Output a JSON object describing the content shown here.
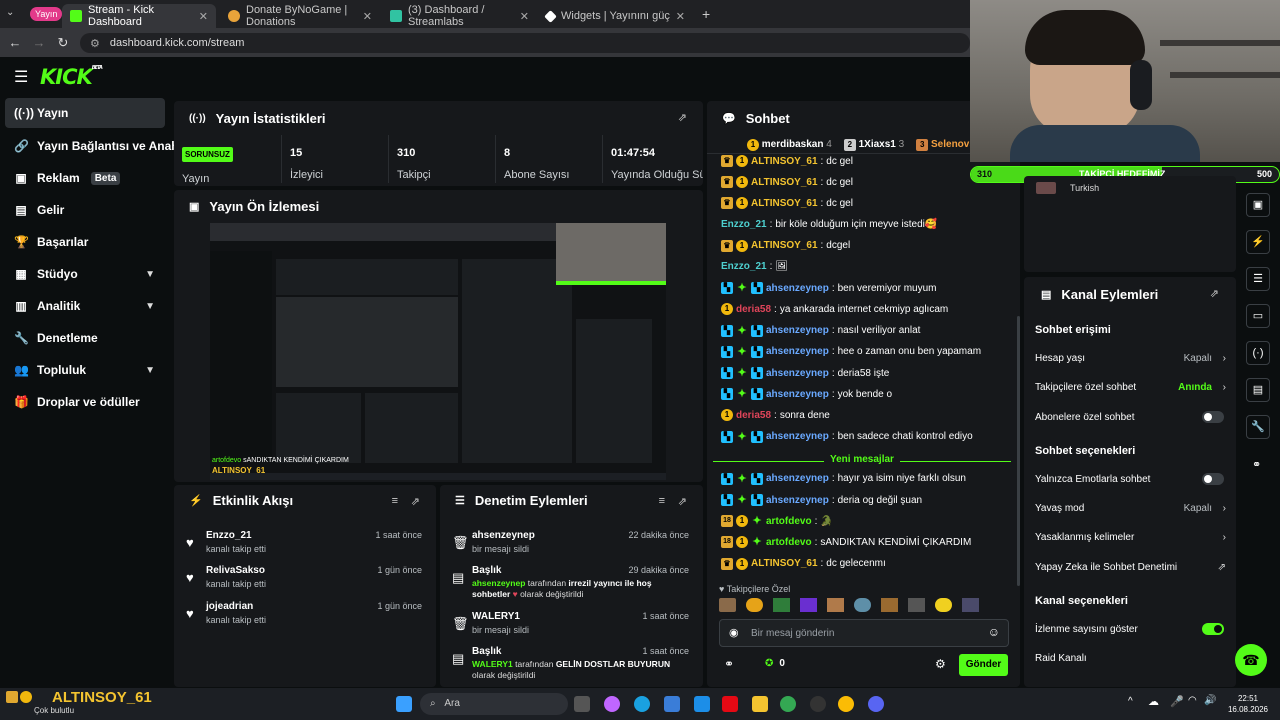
{
  "browser": {
    "profile_label": "Yayın",
    "tabs": [
      {
        "title": "Stream - Kick Dashboard",
        "active": true,
        "color": "#53fc18"
      },
      {
        "title": "Donate ByNoGame | Donations",
        "active": false,
        "color": "#e8a33a"
      },
      {
        "title": "(3) Dashboard / Streamlabs",
        "active": false,
        "color": "#31c3a2"
      },
      {
        "title": "Widgets | Yayınını güçlendirme",
        "active": false,
        "color": "#ffffff"
      }
    ],
    "url": "dashboard.kick.com/stream"
  },
  "header": {
    "logo": "KICK",
    "logo_sup": "BETA"
  },
  "sidebar": {
    "items": [
      {
        "label": "Yayın",
        "icon": "broadcast-icon",
        "active": true
      },
      {
        "label": "Yayın Bağlantısı ve Anahtarı",
        "icon": "link-icon"
      },
      {
        "label": "Reklam",
        "icon": "ad-icon",
        "badge": "Beta"
      },
      {
        "label": "Gelir",
        "icon": "revenue-icon"
      },
      {
        "label": "Başarılar",
        "icon": "trophy-icon"
      },
      {
        "label": "Stüdyo",
        "icon": "studio-icon",
        "expandable": true
      },
      {
        "label": "Analitik",
        "icon": "analytics-icon",
        "expandable": true
      },
      {
        "label": "Denetleme",
        "icon": "wrench-icon"
      },
      {
        "label": "Topluluk",
        "icon": "community-icon",
        "expandable": true
      },
      {
        "label": "Droplar ve ödüller",
        "icon": "gift-icon"
      }
    ]
  },
  "stats": {
    "title": "Yayın İstatistikleri",
    "status_badge": "SORUNSUZ",
    "status_label": "Yayın",
    "items": [
      {
        "value": "15",
        "label": "İzleyici"
      },
      {
        "value": "310",
        "label": "Takipçi"
      },
      {
        "value": "8",
        "label": "Abone Sayısı"
      },
      {
        "value": "01:47:54",
        "label": "Yayında Olduğu Süre"
      }
    ]
  },
  "preview": {
    "title": "Yayın Ön İzlemesi",
    "overlay_user": "artofdevo",
    "overlay_text": "sANDIKTAN KENDİMİ ÇIKARDIM",
    "overlay_name": "ALTINSOY_61"
  },
  "activity": {
    "title": "Etkinlik Akışı",
    "events": [
      {
        "name": "Enzzo_21",
        "desc": "kanalı takip etti",
        "time": "1 saat önce"
      },
      {
        "name": "RelivaSakso",
        "desc": "kanalı takip etti",
        "time": "1 gün önce"
      },
      {
        "name": "jojeadrian",
        "desc": "kanalı takip etti",
        "time": "1 gün önce"
      }
    ]
  },
  "moderation": {
    "title": "Denetim Eylemleri",
    "events": [
      {
        "name": "ahsenzeynep",
        "desc": "bir mesajı sildi",
        "time": "22 dakika önce",
        "icon": "trash-icon"
      },
      {
        "name": "Başlık",
        "actor": "ahsenzeynep",
        "mid": "tarafından",
        "from": "irrezil yayıncı ile hoş sohbetler",
        "to": "olarak değiştirildi",
        "time": "29 dakika önce",
        "icon": "title-icon"
      },
      {
        "name": "WALERY1",
        "desc": "bir mesajı sildi",
        "time": "1 saat önce",
        "icon": "trash-icon"
      },
      {
        "name": "Başlık",
        "actor": "WALERY1",
        "mid": "tarafından",
        "from": "GELİN DOSTLAR BUYURUN",
        "to": "olarak değiştirildi",
        "time": "1 saat önce",
        "icon": "title-icon"
      }
    ]
  },
  "chat": {
    "title": "Sohbet",
    "top_gifters": [
      {
        "rank": "1",
        "name": "merdibaskan",
        "count": "4"
      },
      {
        "rank": "2",
        "name": "1Xiaxs1",
        "count": "3"
      },
      {
        "rank": "3",
        "name": "Selenovsk",
        "count": ""
      }
    ],
    "messages": [
      {
        "user": "ALTINSOY_61",
        "cls": "u-alt",
        "badges": [
          "crown",
          "one"
        ],
        "text": "dc gel"
      },
      {
        "user": "ALTINSOY_61",
        "cls": "u-alt",
        "badges": [
          "crown",
          "one"
        ],
        "text": "dc gel"
      },
      {
        "user": "ALTINSOY_61",
        "cls": "u-alt",
        "badges": [
          "crown",
          "one"
        ],
        "text": "dc gel"
      },
      {
        "user": "Enzzo_21",
        "cls": "u-enz",
        "badges": [],
        "text": "bir köle olduğum için meyve istedi🥰"
      },
      {
        "user": "ALTINSOY_61",
        "cls": "u-alt",
        "badges": [
          "crown",
          "one"
        ],
        "text": "dcgel"
      },
      {
        "user": "Enzzo_21",
        "cls": "u-enz",
        "badges": [],
        "text": "🖼"
      },
      {
        "user": "ahsenzeynep",
        "cls": "u-ahs",
        "badges": [
          "mod",
          "spark",
          "mod"
        ],
        "text": "ben veremiyor muyum"
      },
      {
        "user": "deria58",
        "cls": "u-der",
        "badges": [
          "one"
        ],
        "text": "ya ankarada internet cekmiyp aglıcam"
      },
      {
        "user": "ahsenzeynep",
        "cls": "u-ahs",
        "badges": [
          "mod",
          "spark",
          "mod"
        ],
        "text": "nasıl veriliyor anlat"
      },
      {
        "user": "ahsenzeynep",
        "cls": "u-ahs",
        "badges": [
          "mod",
          "spark",
          "mod"
        ],
        "text": "hee o zaman onu ben yapamam"
      },
      {
        "user": "ahsenzeynep",
        "cls": "u-ahs",
        "badges": [
          "mod",
          "spark",
          "mod"
        ],
        "text": "deria58 işte"
      },
      {
        "user": "ahsenzeynep",
        "cls": "u-ahs",
        "badges": [
          "mod",
          "spark",
          "mod"
        ],
        "text": "yok bende o"
      },
      {
        "user": "deria58",
        "cls": "u-der",
        "badges": [
          "one"
        ],
        "text": "sonra dene"
      },
      {
        "user": "ahsenzeynep",
        "cls": "u-ahs",
        "badges": [
          "mod",
          "spark",
          "mod"
        ],
        "text": "ben sadece chati kontrol ediyo"
      }
    ],
    "new_messages_label": "Yeni mesajlar",
    "new_messages": [
      {
        "user": "ahsenzeynep",
        "cls": "u-ahs",
        "badges": [
          "mod",
          "spark",
          "mod"
        ],
        "text": "hayır ya isim niye farklı olsun"
      },
      {
        "user": "ahsenzeynep",
        "cls": "u-ahs",
        "badges": [
          "mod",
          "spark",
          "mod"
        ],
        "text": "deria og değil şuan"
      },
      {
        "user": "artofdevo",
        "cls": "u-art",
        "badges": [
          "crown18",
          "one",
          "spark"
        ],
        "text": "🐊"
      },
      {
        "user": "artofdevo",
        "cls": "u-art",
        "badges": [
          "crown18",
          "one",
          "spark"
        ],
        "text": "sANDIKTAN KENDİMİ ÇIKARDIM"
      },
      {
        "user": "ALTINSOY_61",
        "cls": "u-alt",
        "badges": [
          "crown",
          "one"
        ],
        "text": "dc gelecenmı"
      }
    ],
    "followers_only_label": "Takipçilere Özel",
    "input_placeholder": "Bir mesaj gönderin",
    "points": "0",
    "send_label": "Gönder"
  },
  "follower_goal": {
    "label": "TAKİPÇİ HEDEFİMİZ",
    "current": "310",
    "target": "500",
    "progress": 0.62
  },
  "webcam_caption": "Turkish",
  "channel_actions": {
    "title": "Kanal Eylemleri",
    "chat_access_title": "Sohbet erişimi",
    "account_age_label": "Hesap yaşı",
    "account_age_value": "Kapalı",
    "followers_only_label": "Takipçilere özel sohbet",
    "followers_only_value": "Anında",
    "subs_only_label": "Abonelere özel sohbet",
    "chat_options_title": "Sohbet seçenekleri",
    "emote_only_label": "Yalnızca Emotlarla sohbet",
    "slow_mode_label": "Yavaş mod",
    "slow_mode_value": "Kapalı",
    "banned_words_label": "Yasaklanmış kelimeler",
    "ai_mod_label": "Yapay Zeka ile Sohbet Denetimi",
    "channel_options_title": "Kanal seçenekleri",
    "show_viewers_label": "İzlenme sayısını göster",
    "raid_label": "Raid Kanalı"
  },
  "taskbar": {
    "overlay_name": "ALTINSOY_61",
    "weather": "Çok bulutlu",
    "search_placeholder": "Ara",
    "time": "22:51",
    "date": "16.08.2026"
  },
  "colors": {
    "accent": "#53fc18",
    "panel": "#16181b",
    "bg": "#0b0e0f"
  }
}
